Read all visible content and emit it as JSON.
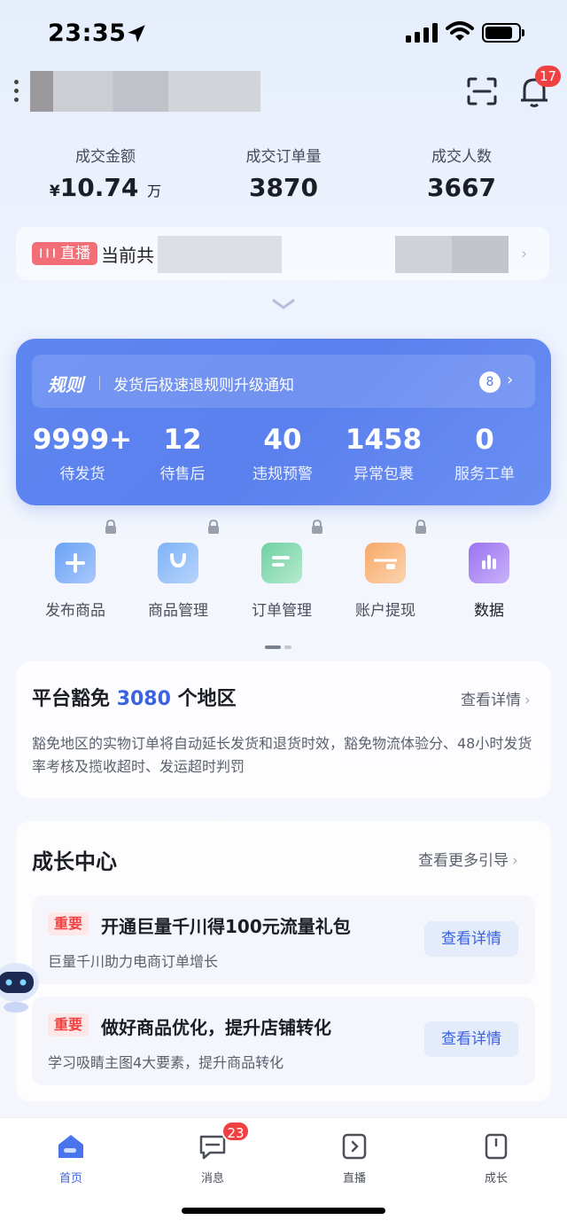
{
  "status": {
    "time": "23:35"
  },
  "header": {
    "notification_count": "17"
  },
  "stats": [
    {
      "label": "成交金额",
      "currency": "¥",
      "value": "10.74",
      "unit": "万"
    },
    {
      "label": "成交订单量",
      "value": "3870"
    },
    {
      "label": "成交人数",
      "value": "3667"
    }
  ],
  "live": {
    "tag": "直播",
    "text": "当前共"
  },
  "rule": {
    "tag": "规则",
    "text": "发货后极速退规则升级通知",
    "count": "8"
  },
  "metrics": [
    {
      "value": "9999+",
      "label": "待发货"
    },
    {
      "value": "12",
      "label": "待售后"
    },
    {
      "value": "40",
      "label": "违规预警"
    },
    {
      "value": "1458",
      "label": "异常包裹"
    },
    {
      "value": "0",
      "label": "服务工单"
    }
  ],
  "quick_actions": [
    {
      "label": "发布商品",
      "icon": "publish-icon"
    },
    {
      "label": "商品管理",
      "icon": "bag-icon"
    },
    {
      "label": "订单管理",
      "icon": "order-icon"
    },
    {
      "label": "账户提现",
      "icon": "wallet-icon"
    },
    {
      "label": "数据",
      "icon": "chart-icon"
    }
  ],
  "exempt": {
    "title_prefix": "平台豁免",
    "count": "3080",
    "title_suffix": "个地区",
    "more": "查看详情",
    "desc": "豁免地区的实物订单将自动延长发货和退货时效，豁免物流体验分、48小时发货率考核及揽收超时、发运超时判罚"
  },
  "growth": {
    "title": "成长中心",
    "more": "查看更多引导",
    "tasks": [
      {
        "tag": "重要",
        "title": "开通巨量千川得100元流量礼包",
        "sub": "巨量千川助力电商订单增长",
        "button": "查看详情"
      },
      {
        "tag": "重要",
        "title": "做好商品优化，提升店铺转化",
        "sub": "学习吸睛主图4大要素，提升商品转化",
        "button": "查看详情"
      }
    ]
  },
  "tabs": [
    {
      "label": "首页"
    },
    {
      "label": "消息",
      "badge": "23"
    },
    {
      "label": "直播"
    },
    {
      "label": "成长"
    }
  ],
  "colors": {
    "accent": "#3b62e0",
    "card_blue": "#5a80ee",
    "badge_red": "#f04142"
  }
}
